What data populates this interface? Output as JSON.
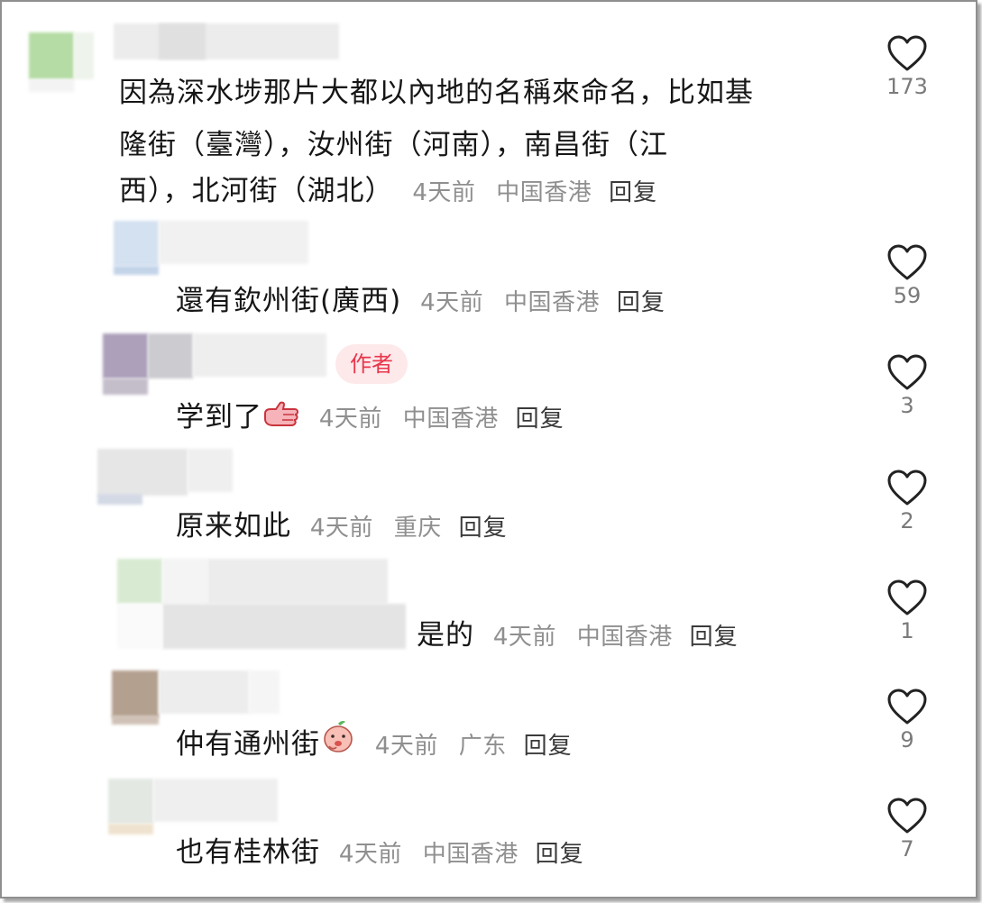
{
  "comments": [
    {
      "lines": [
        "因為深水埗那片大都以內地的名稱來命名，比如基",
        "隆街（臺灣），汝州街（河南），南昌街（江",
        "西），北河街（湖北）"
      ],
      "time": "4天前",
      "location": "中国香港",
      "reply": "回复",
      "likes": "173"
    },
    {
      "text": "還有欽州街(廣西)",
      "time": "4天前",
      "location": "中国香港",
      "reply": "回复",
      "likes": "59"
    },
    {
      "text": "学到了",
      "emoji": "thumbs-up-emoji",
      "author_tag": "作者",
      "time": "4天前",
      "location": "中国香港",
      "reply": "回复",
      "likes": "3"
    },
    {
      "text": "原来如此",
      "time": "4天前",
      "location": "重庆",
      "reply": "回复",
      "likes": "2"
    },
    {
      "text": "是的",
      "time": "4天前",
      "location": "中国香港",
      "reply": "回复",
      "likes": "1"
    },
    {
      "text": "仲有通州街",
      "emoji": "peach-face-emoji",
      "time": "4天前",
      "location": "广东",
      "reply": "回复",
      "likes": "9"
    },
    {
      "text": "也有桂林街",
      "time": "4天前",
      "location": "中国香港",
      "reply": "回复",
      "likes": "7"
    }
  ],
  "colors": {
    "author_tag_bg": "#fde8ea",
    "author_tag_text": "#e8364b",
    "meta": "#8f8f8f"
  },
  "icons": {
    "like": "heart-outline-icon"
  }
}
